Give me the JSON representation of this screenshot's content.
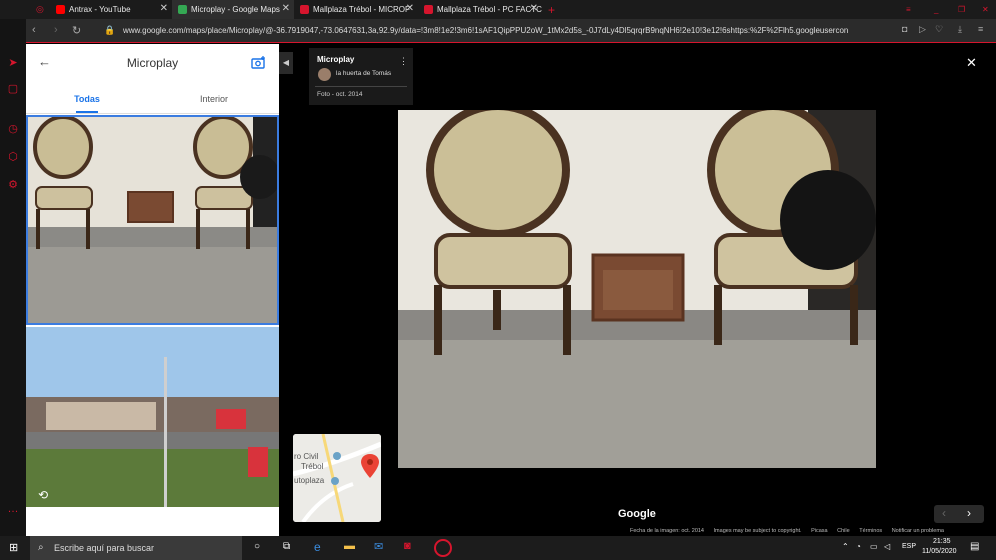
{
  "browser": {
    "tabs": [
      {
        "label": "Antrax - YouTube",
        "favicon_color": "#ff0000"
      },
      {
        "label": "Microplay - Google Maps",
        "favicon_color": "#34a853"
      },
      {
        "label": "Mallplaza Trébol - MICROF",
        "favicon_color": "#d6152d"
      },
      {
        "label": "Mallplaza Trébol - PC FACTC",
        "favicon_color": "#d6152d"
      }
    ],
    "url": "www.google.com/maps/place/Microplay/@-36.7919047,-73.0647631,3a,92.9y/data=!3m8!1e2!3m6!1sAF1QipPPU2oW_1tMx2d5s_-0J7dLy4Dl5qrqrB9nqNH6!2e10!3e12!6shttps:%2F%2Flh5.googleusercon"
  },
  "panel": {
    "title": "Microplay",
    "tabs": [
      "Todas",
      "Interior"
    ],
    "active_tab": "Todas"
  },
  "infocard": {
    "place": "Microplay",
    "author": "la huerta de Tomás",
    "date": "Foto - oct. 2014"
  },
  "minimap": {
    "labels": [
      "ro Civil",
      "Trébol",
      "utoplaza"
    ]
  },
  "viewer": {
    "brand": "Google"
  },
  "attribution": {
    "items": [
      "Fecha de la imagen: oct. 2014",
      "Images may be subject to copyright.",
      "Picasa",
      "Chile",
      "Términos",
      "Notificar un problema"
    ]
  },
  "taskbar": {
    "search_placeholder": "Escribe aquí para buscar",
    "lang": "ESP",
    "time": "21:35",
    "date": "11/05/2020"
  },
  "colors": {
    "accent": "#d6152d",
    "tab_active": "#1a73e8"
  }
}
